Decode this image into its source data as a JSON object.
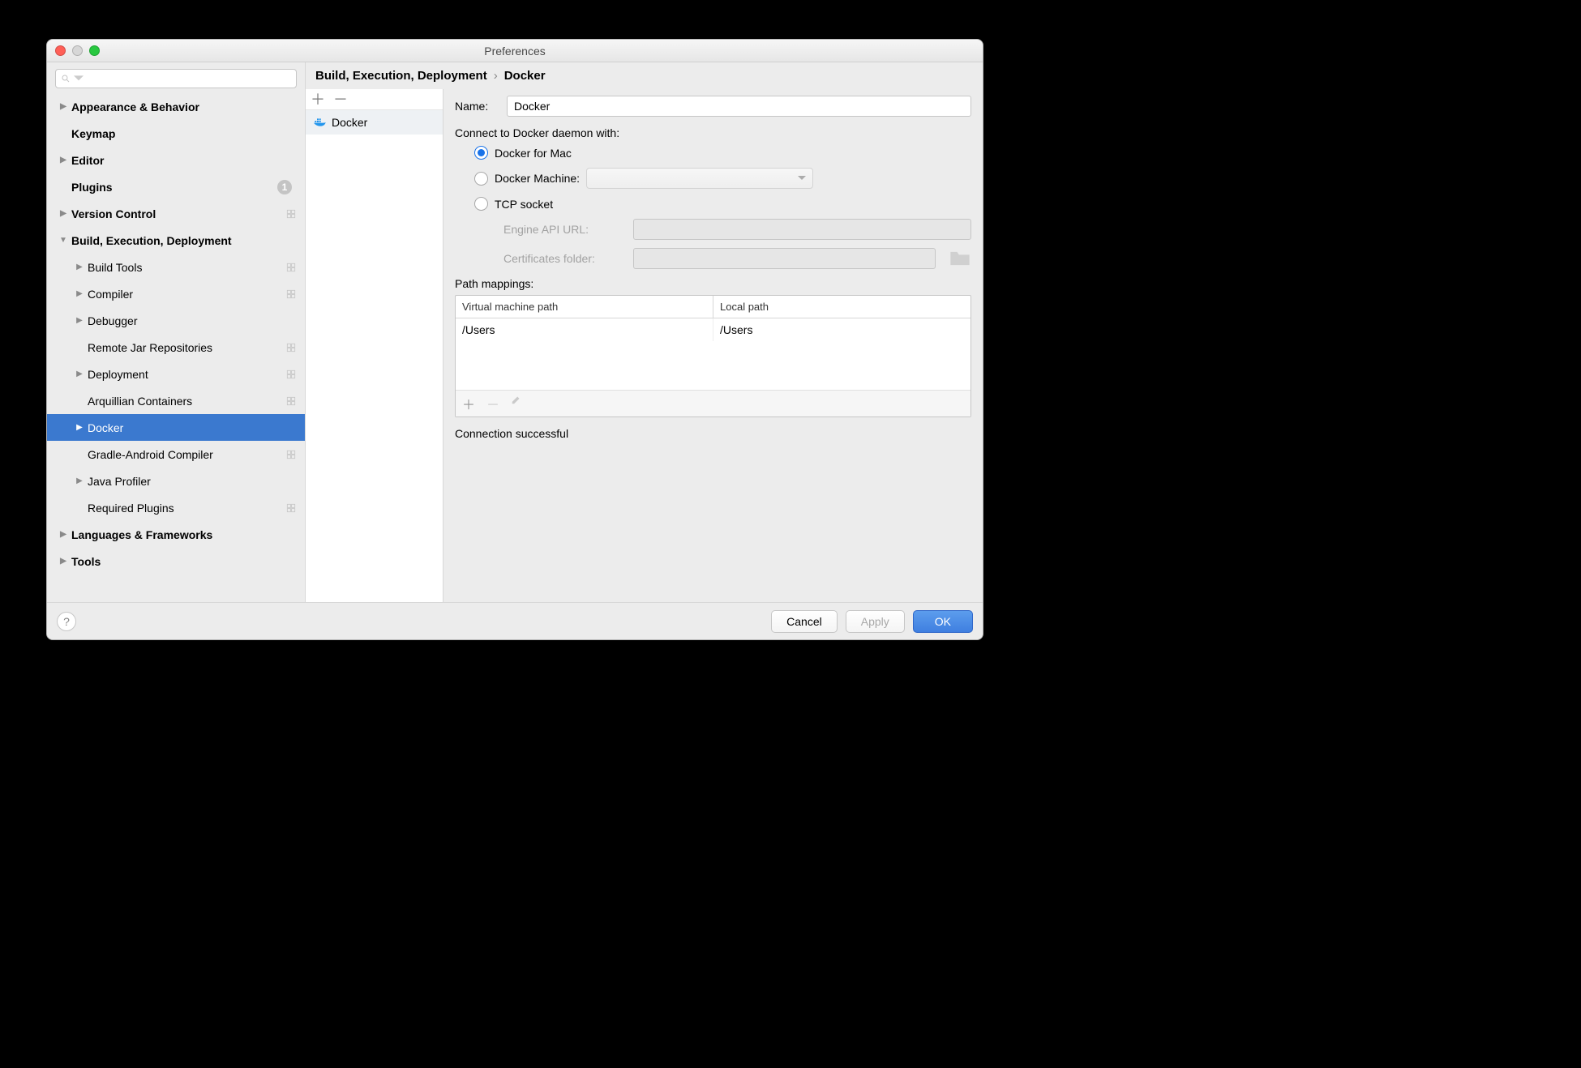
{
  "window": {
    "title": "Preferences"
  },
  "sidebar": {
    "search_placeholder": "",
    "rows": [
      {
        "label": "Appearance & Behavior",
        "depth": 0,
        "arrow": "right",
        "bold": true
      },
      {
        "label": "Keymap",
        "depth": 0,
        "arrow": "",
        "bold": true
      },
      {
        "label": "Editor",
        "depth": 0,
        "arrow": "right",
        "bold": true
      },
      {
        "label": "Plugins",
        "depth": 0,
        "arrow": "",
        "bold": true,
        "badge": "1"
      },
      {
        "label": "Version Control",
        "depth": 0,
        "arrow": "right",
        "bold": true,
        "cube": true
      },
      {
        "label": "Build, Execution, Deployment",
        "depth": 0,
        "arrow": "down",
        "bold": true
      },
      {
        "label": "Build Tools",
        "depth": 1,
        "arrow": "right",
        "cube": true
      },
      {
        "label": "Compiler",
        "depth": 1,
        "arrow": "right",
        "cube": true
      },
      {
        "label": "Debugger",
        "depth": 1,
        "arrow": "right"
      },
      {
        "label": "Remote Jar Repositories",
        "depth": 1,
        "arrow": "",
        "cube": true
      },
      {
        "label": "Deployment",
        "depth": 1,
        "arrow": "right",
        "cube": true
      },
      {
        "label": "Arquillian Containers",
        "depth": 1,
        "arrow": "",
        "cube": true
      },
      {
        "label": "Docker",
        "depth": 1,
        "arrow": "right",
        "selected": true
      },
      {
        "label": "Gradle-Android Compiler",
        "depth": 1,
        "arrow": "",
        "cube": true
      },
      {
        "label": "Java Profiler",
        "depth": 1,
        "arrow": "right"
      },
      {
        "label": "Required Plugins",
        "depth": 1,
        "arrow": "",
        "cube": true
      },
      {
        "label": "Languages & Frameworks",
        "depth": 0,
        "arrow": "right",
        "bold": true
      },
      {
        "label": "Tools",
        "depth": 0,
        "arrow": "right",
        "bold": true
      }
    ]
  },
  "breadcrumb": {
    "parent": "Build, Execution, Deployment",
    "sep": "›",
    "current": "Docker"
  },
  "midlist": {
    "items": [
      {
        "label": "Docker"
      }
    ]
  },
  "detail": {
    "name_label": "Name:",
    "name_value": "Docker",
    "connect_label": "Connect to Docker daemon with:",
    "option_for_mac": "Docker for Mac",
    "option_machine": "Docker Machine:",
    "option_tcp": "TCP socket",
    "engine_label": "Engine API URL:",
    "engine_value": "",
    "cert_label": "Certificates folder:",
    "cert_value": "",
    "selected_option": "for_mac",
    "path_mappings_label": "Path mappings:",
    "pm_headers": {
      "vm": "Virtual machine path",
      "local": "Local path"
    },
    "pm_rows": [
      {
        "vm": "/Users",
        "local": "/Users"
      }
    ],
    "status": "Connection successful"
  },
  "footer": {
    "cancel": "Cancel",
    "apply": "Apply",
    "ok": "OK"
  }
}
